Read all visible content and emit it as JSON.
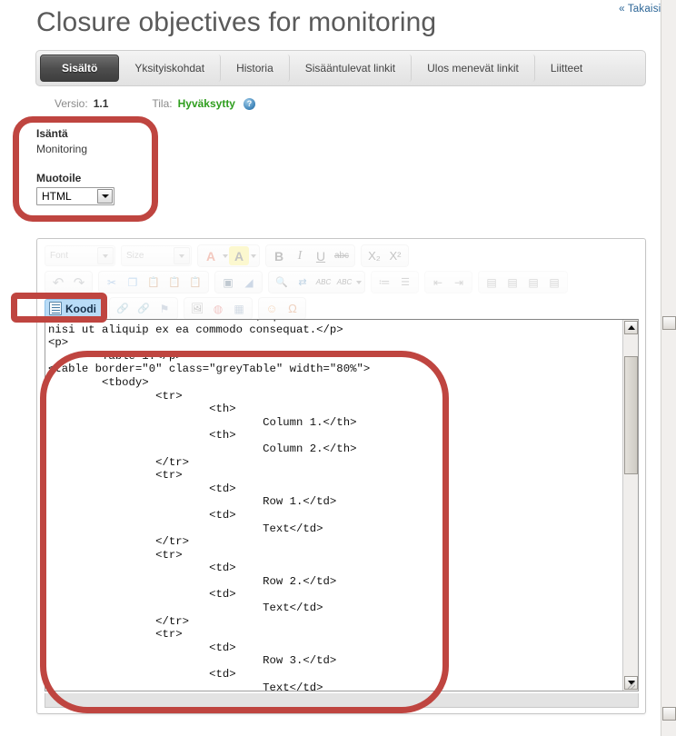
{
  "header": {
    "back_link": "« Takaisin",
    "title": "Closure objectives for monitoring"
  },
  "tabs": [
    {
      "label": "Sisältö",
      "active": true
    },
    {
      "label": "Yksityiskohdat",
      "active": false
    },
    {
      "label": "Historia",
      "active": false
    },
    {
      "label": "Sisääntulevat linkit",
      "active": false
    },
    {
      "label": "Ulos menevät linkit",
      "active": false
    },
    {
      "label": "Liitteet",
      "active": false
    }
  ],
  "meta": {
    "version_label": "Versio:",
    "version_value": "1.1",
    "status_label": "Tila:",
    "status_value": "Hyväksytty",
    "status_color": "#2f9e1e",
    "help_icon_glyph": "?"
  },
  "fields": {
    "host_label": "Isäntä",
    "host_value": "Monitoring",
    "format_label": "Muotoile",
    "format_value": "HTML",
    "format_options": [
      "HTML"
    ]
  },
  "editor": {
    "row1": {
      "font_combo_placeholder": "Font",
      "size_combo_placeholder": "Size",
      "buttons": [
        {
          "name": "text-color-icon",
          "glyph": "A"
        },
        {
          "name": "background-color-icon",
          "glyph": "A"
        },
        {
          "name": "bold-icon",
          "glyph": "B"
        },
        {
          "name": "italic-icon",
          "glyph": "I"
        },
        {
          "name": "underline-icon",
          "glyph": "U"
        },
        {
          "name": "strikethrough-icon",
          "glyph": "abc"
        },
        {
          "name": "subscript-icon",
          "glyph": "X₂"
        },
        {
          "name": "superscript-icon",
          "glyph": "X²"
        }
      ]
    },
    "row2": {
      "buttons": [
        {
          "name": "undo-icon",
          "glyph": "↶"
        },
        {
          "name": "redo-icon",
          "glyph": "↷"
        },
        {
          "name": "cut-icon",
          "glyph": "✂"
        },
        {
          "name": "copy-icon",
          "glyph": "❐"
        },
        {
          "name": "paste-icon",
          "glyph": "📋"
        },
        {
          "name": "paste-text-icon",
          "glyph": "📋"
        },
        {
          "name": "paste-word-icon",
          "glyph": "📋"
        },
        {
          "name": "select-all-icon",
          "glyph": "▣"
        },
        {
          "name": "remove-format-icon",
          "glyph": "◢"
        },
        {
          "name": "find-icon",
          "glyph": "🔍"
        },
        {
          "name": "replace-icon",
          "glyph": "⇄"
        },
        {
          "name": "spellcheck-icon",
          "glyph": "ABC"
        },
        {
          "name": "spellcheck-options-icon",
          "glyph": "ABC"
        },
        {
          "name": "numbered-list-icon",
          "glyph": "≔"
        },
        {
          "name": "bulleted-list-icon",
          "glyph": "☰"
        },
        {
          "name": "decrease-indent-icon",
          "glyph": "⇤"
        },
        {
          "name": "increase-indent-icon",
          "glyph": "⇥"
        },
        {
          "name": "align-left-icon",
          "glyph": "▤"
        },
        {
          "name": "align-center-icon",
          "glyph": "▤"
        },
        {
          "name": "align-right-icon",
          "glyph": "▤"
        },
        {
          "name": "justify-icon",
          "glyph": "▤"
        }
      ]
    },
    "row3": {
      "source_button_label": "Koodi",
      "source_button_active": true,
      "buttons": [
        {
          "name": "link-icon",
          "glyph": "🔗"
        },
        {
          "name": "unlink-icon",
          "glyph": "🔗"
        },
        {
          "name": "anchor-icon",
          "glyph": "⚑"
        },
        {
          "name": "image-icon",
          "glyph": "🖼"
        },
        {
          "name": "flash-icon",
          "glyph": "◍"
        },
        {
          "name": "table-icon",
          "glyph": "▦"
        },
        {
          "name": "smiley-icon",
          "glyph": "☺"
        },
        {
          "name": "special-char-icon",
          "glyph": "Ω"
        }
      ]
    },
    "code": "aliqua. Ut enim ad minim veniam, quis nostrud exercitation ullamco laboris\nnisi ut aliquip ex ea commodo consequat.</p>\n<p>\n        Table 1.</p>\n<table border=\"0\" class=\"greyTable\" width=\"80%\">\n        <tbody>\n                <tr>\n                        <th>\n                                Column 1.</th>\n                        <th>\n                                Column 2.</th>\n                </tr>\n                <tr>\n                        <td>\n                                Row 1.</td>\n                        <td>\n                                Text</td>\n                </tr>\n                <tr>\n                        <td>\n                                Row 2.</td>\n                        <td>\n                                Text</td>\n                </tr>\n                <tr>\n                        <td>\n                                Row 3.</td>\n                        <td>\n                                Text</td>\n                </tr>"
  },
  "annotations": {
    "accent_color": "#bf4540",
    "items": [
      {
        "name": "metadata-fields-highlight"
      },
      {
        "name": "koodi-button-highlight"
      },
      {
        "name": "code-block-highlight"
      }
    ]
  }
}
